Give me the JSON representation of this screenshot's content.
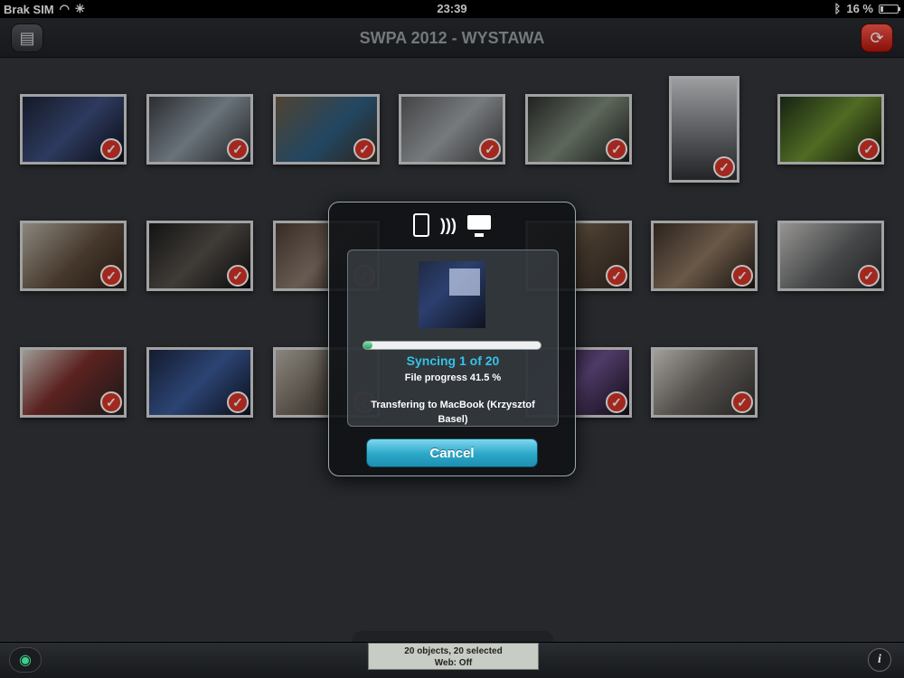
{
  "status_bar": {
    "carrier": "Brak SIM",
    "time": "23:39",
    "battery": "16 %"
  },
  "nav": {
    "title": "SWPA 2012 - WYSTAWA",
    "left_icon": "archive-icon",
    "right_icon": "sync-icon"
  },
  "colors": {
    "check": "#d9362a",
    "sync_accent": "#34c3e6",
    "cancel_button": "#2aa7c8"
  },
  "photos": [
    {
      "name": "photo-1",
      "selected": true
    },
    {
      "name": "photo-2",
      "selected": true
    },
    {
      "name": "photo-3",
      "selected": true
    },
    {
      "name": "photo-4",
      "selected": true
    },
    {
      "name": "photo-5",
      "selected": true
    },
    {
      "name": "photo-6",
      "selected": true
    },
    {
      "name": "photo-7",
      "selected": true
    },
    {
      "name": "photo-8",
      "selected": true
    },
    {
      "name": "photo-9",
      "selected": true
    },
    {
      "name": "photo-10",
      "selected": true
    },
    {
      "name": "photo-11",
      "selected": true
    },
    {
      "name": "photo-12",
      "selected": true
    },
    {
      "name": "photo-13",
      "selected": true
    },
    {
      "name": "photo-14",
      "selected": true
    },
    {
      "name": "photo-15",
      "selected": true
    },
    {
      "name": "photo-16",
      "selected": true
    },
    {
      "name": "photo-17",
      "selected": true
    },
    {
      "name": "photo-18",
      "selected": true
    },
    {
      "name": "photo-19",
      "selected": true
    },
    {
      "name": "photo-20",
      "selected": true
    }
  ],
  "sync_dialog": {
    "icons": [
      "ipad-icon",
      "wireless-icon",
      "monitor-icon"
    ],
    "progress_fraction": 0.05,
    "sync_text": "Syncing 1 of 20",
    "file_progress": "File progress 41.5 %",
    "transfer_text": "Transfering to MacBook (Krzysztof Basel)",
    "cancel_label": "Cancel"
  },
  "toolbar": {
    "status_line1": "20 objects, 20 selected",
    "status_line2": "Web: Off",
    "left_icon": "eye-icon",
    "right_icon": "info-icon"
  }
}
